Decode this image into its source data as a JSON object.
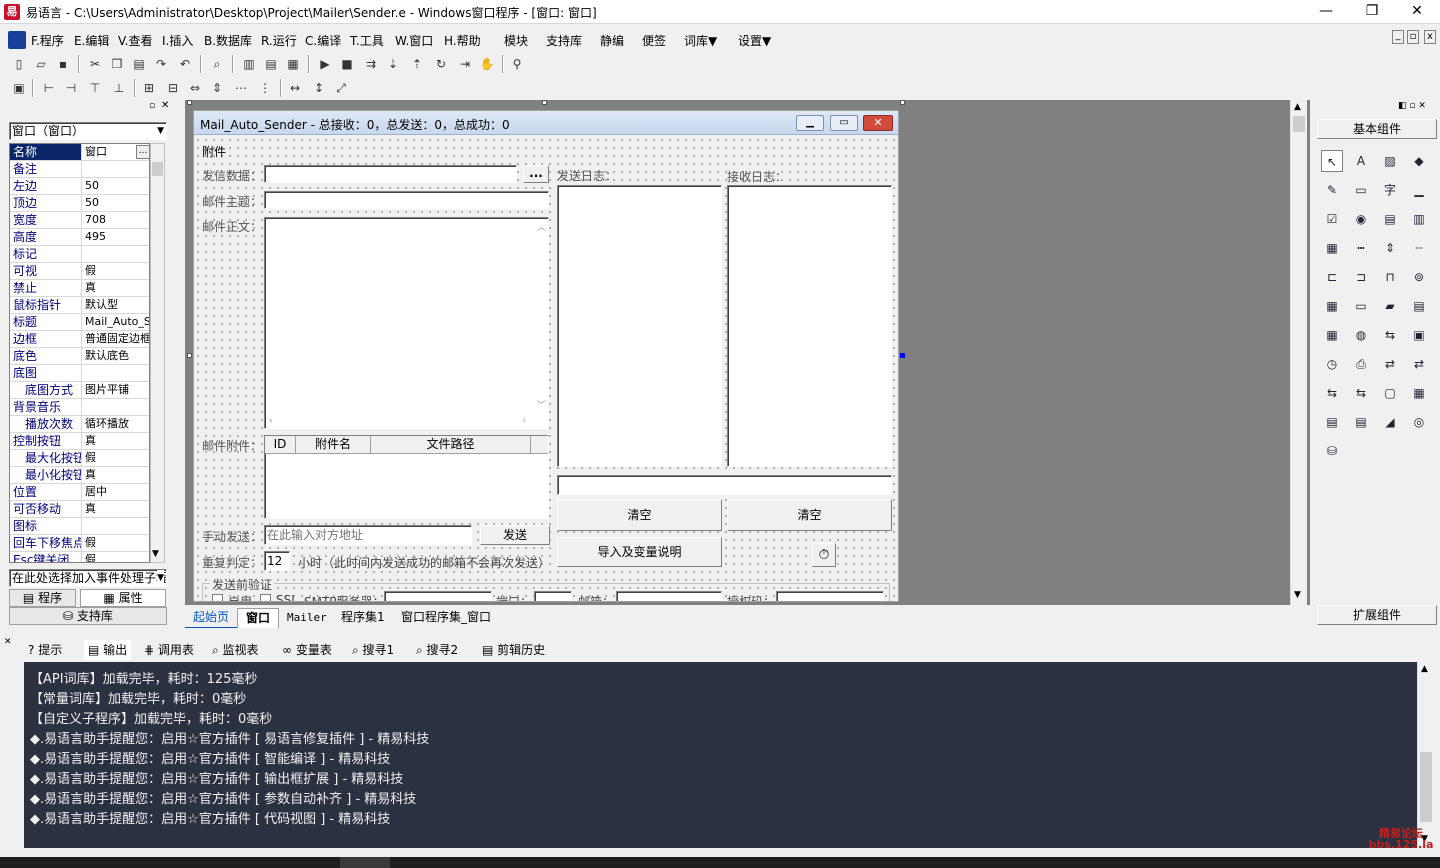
{
  "window": {
    "app_icon": "易",
    "title": "易语言 - C:\\Users\\Administrator\\Desktop\\Project\\Mailer\\Sender.e - Windows窗口程序 - [窗口: 窗口]",
    "minimize": "—",
    "restore": "❐",
    "close": "✕"
  },
  "menu": {
    "items": [
      "F.程序",
      "E.编辑",
      "V.查看",
      "I.插入",
      "B.数据库",
      "R.运行",
      "C.编译",
      "T.工具",
      "W.窗口",
      "H.帮助",
      "模块",
      "支持库",
      "静编",
      "便签",
      "词库▼",
      "设置▼"
    ],
    "mdi_controls": [
      "_",
      "▫",
      "x"
    ]
  },
  "left_panel": {
    "object_select": "窗口（窗口）",
    "properties": [
      {
        "name": "名称",
        "value": "窗口",
        "selected": true
      },
      {
        "name": "备注",
        "value": ""
      },
      {
        "name": "左边",
        "value": "50"
      },
      {
        "name": "顶边",
        "value": "50"
      },
      {
        "name": "宽度",
        "value": "708"
      },
      {
        "name": "高度",
        "value": "495"
      },
      {
        "name": "标记",
        "value": ""
      },
      {
        "name": "可视",
        "value": "假"
      },
      {
        "name": "禁止",
        "value": "真"
      },
      {
        "name": "鼠标指针",
        "value": "默认型"
      },
      {
        "name": "标题",
        "value": "Mail_Auto_S"
      },
      {
        "name": "边框",
        "value": "普通固定边框"
      },
      {
        "name": "底色",
        "value": "默认底色"
      },
      {
        "name": "底图",
        "value": ""
      },
      {
        "name": "底图方式",
        "value": "图片平铺",
        "sub": true
      },
      {
        "name": "背景音乐",
        "value": ""
      },
      {
        "name": "播放次数",
        "value": "循环播放",
        "sub": true
      },
      {
        "name": "控制按钮",
        "value": "真"
      },
      {
        "name": "最大化按钮",
        "value": "假",
        "sub": true
      },
      {
        "name": "最小化按钮",
        "value": "真",
        "sub": true
      },
      {
        "name": "位置",
        "value": "居中"
      },
      {
        "name": "可否移动",
        "value": "真"
      },
      {
        "name": "图标",
        "value": ""
      },
      {
        "name": "回车下移焦点",
        "value": "假"
      },
      {
        "name": "Esc键关闭",
        "value": "假"
      }
    ],
    "event_select": "在此处选择加入事件处理子程序",
    "tab_program": "程序",
    "tab_property": "属性",
    "tab_support": "支持库"
  },
  "designer": {
    "caption": "Mail_Auto_Sender - 总接收：0，总发送：0，总成功：0",
    "menu_attachment": "附件",
    "label_sender_data": "发信数据：",
    "browse_button": "...",
    "label_subject": "邮件主题：",
    "label_body": "邮件正文：",
    "label_send_log": "发送日志：",
    "label_recv_log": "接收日志：",
    "label_attach": "邮件附件：",
    "attach_cols": [
      "ID",
      "附件名",
      "文件路径"
    ],
    "clear_send": "清空",
    "clear_recv": "清空",
    "label_manual": "手动发送：",
    "manual_placeholder": "在此输入对方地址",
    "send_button": "发送",
    "import_button": "导入及变量说明",
    "label_repeat": "重复判定：",
    "repeat_value": "12",
    "repeat_hint": "小时（此时间内发送成功的邮箱不会再次发送）",
    "group_verify": "发送前验证",
    "verify_enable": "启用",
    "verify_ssl": "SSL",
    "verify_smtp": "SMTP服务器：",
    "verify_port": "端口：",
    "verify_mail": "邮箱：",
    "verify_auth": "授权码："
  },
  "right_panel": {
    "header": "基本组件",
    "footer": "扩展组件"
  },
  "editor_tabs": [
    "起始页",
    "窗口",
    "Mailer",
    "程序集1",
    "窗口程序集_窗口"
  ],
  "output_tabs": [
    "提示",
    "输出",
    "调用表",
    "监视表",
    "变量表",
    "搜寻1",
    "搜寻2",
    "剪辑历史"
  ],
  "output_lines": [
    "【API词库】加载完毕，耗时：125毫秒",
    "【常量词库】加载完毕，耗时：0毫秒",
    "【自定义子程序】加载完毕，耗时：0毫秒",
    "◆.易语言助手提醒您：启用☆官方插件 [ 易语言修复插件 ] - 精易科技",
    "◆.易语言助手提醒您：启用☆官方插件 [ 智能编译 ] - 精易科技",
    "◆.易语言助手提醒您：启用☆官方插件 [ 输出框扩展 ] - 精易科技",
    "◆.易语言助手提醒您：启用☆官方插件 [ 参数自动补齐 ] - 精易科技",
    "◆.易语言助手提醒您：启用☆官方插件 [ 代码视图 ] - 精易科技"
  ],
  "watermark": "精易论坛 bbs.125.la"
}
